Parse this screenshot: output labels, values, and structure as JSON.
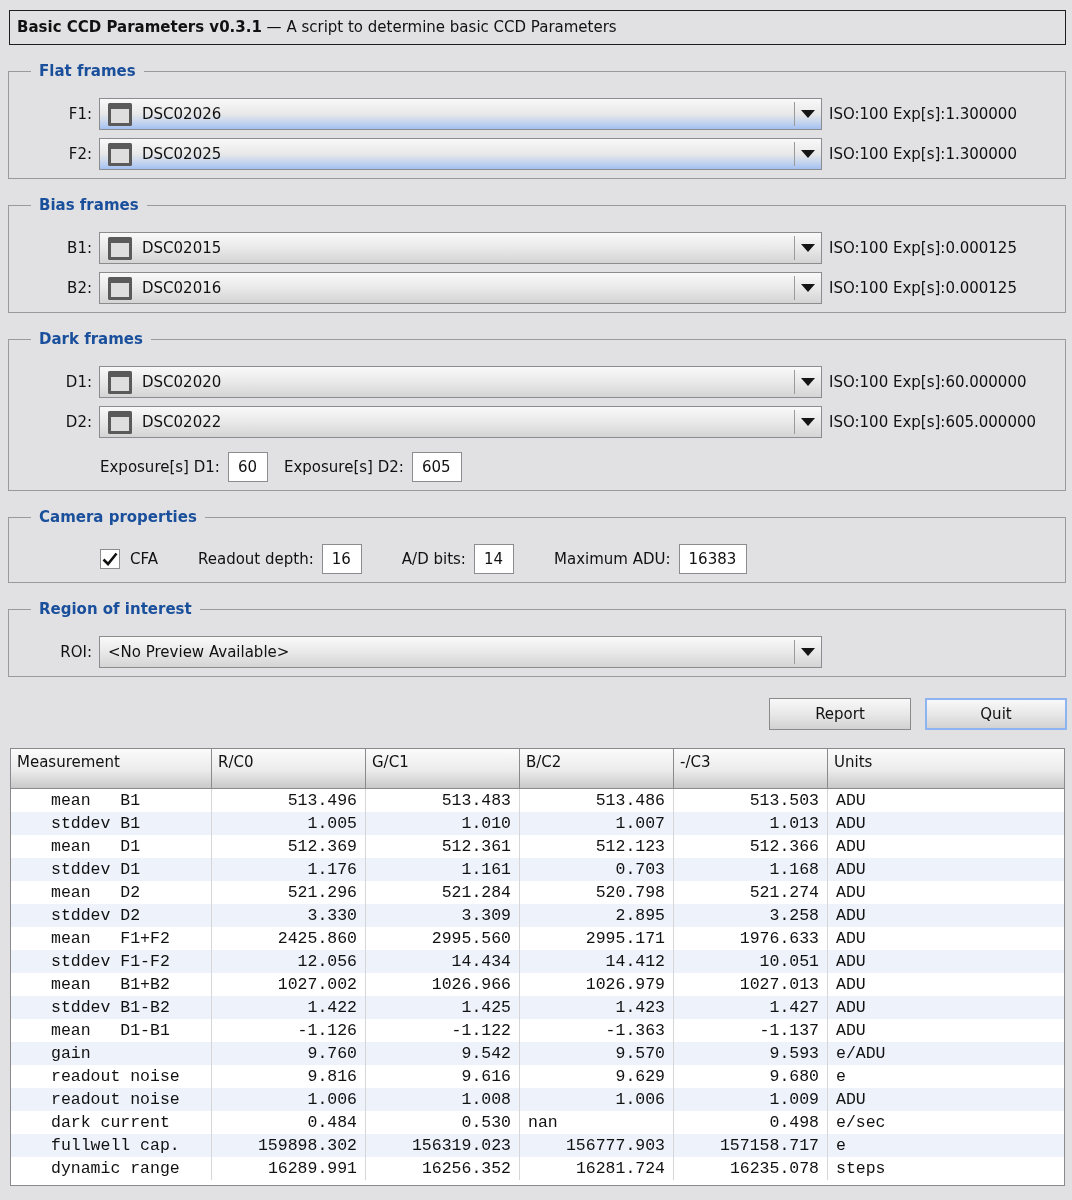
{
  "title": "**Basic CCD Parameters v0.3.1** — A script to determine basic CCD Parameters",
  "groups": [
    {
      "title": "Flat frames",
      "combos": [
        {
          "kind": "image",
          "label": "F1:",
          "value": "DSC02026",
          "highlighted": true,
          "info": "ISO:100 Exp[s]:1.300000"
        },
        {
          "kind": "image",
          "label": "F2:",
          "value": "DSC02025",
          "highlighted": true,
          "info": "ISO:100 Exp[s]:1.300000"
        }
      ]
    },
    {
      "title": "Bias frames",
      "combos": [
        {
          "kind": "image",
          "label": "B1:",
          "value": "DSC02015",
          "highlighted": false,
          "info": "ISO:100 Exp[s]:0.000125"
        },
        {
          "kind": "image",
          "label": "B2:",
          "value": "DSC02016",
          "highlighted": false,
          "info": "ISO:100 Exp[s]:0.000125"
        }
      ]
    },
    {
      "title": "Dark frames",
      "combos": [
        {
          "kind": "image",
          "label": "D1:",
          "value": "DSC02020",
          "highlighted": false,
          "info": "ISO:100 Exp[s]:60.000000"
        },
        {
          "kind": "image",
          "label": "D2:",
          "value": "DSC02022",
          "highlighted": false,
          "info": "ISO:100 Exp[s]:605.000000"
        }
      ],
      "fields": [
        {
          "kind": "number",
          "label": "Exposure[s] D1:",
          "value": "60"
        },
        {
          "kind": "number",
          "label": "Exposure[s] D2:",
          "value": "605"
        }
      ]
    },
    {
      "title": "Camera properties",
      "fields": [
        {
          "kind": "checkbox",
          "label": "CFA",
          "checked": true
        },
        {
          "kind": "number",
          "label": "Readout depth:",
          "value": "16"
        },
        {
          "kind": "number",
          "label": "A/D bits:",
          "value": "14"
        },
        {
          "kind": "number",
          "label": "Maximum ADU:",
          "value": "16383"
        }
      ]
    },
    {
      "title": "Region of interest",
      "combos": [
        {
          "kind": "text",
          "label": "ROI:",
          "value": "<No Preview Available>",
          "highlighted": false
        }
      ]
    }
  ],
  "buttons": [
    {
      "label": "Report",
      "default": false
    },
    {
      "label": "Quit",
      "default": true
    }
  ],
  "table": {
    "columns": [
      "Measurement",
      "R/C0",
      "G/C1",
      "B/C2",
      "-/C3",
      "Units"
    ],
    "rows": [
      {
        "measurement": "mean   B1",
        "values": [
          {
            "text": "513.496",
            "kind": "number"
          },
          {
            "text": "513.483",
            "kind": "number"
          },
          {
            "text": "513.486",
            "kind": "number"
          },
          {
            "text": "513.503",
            "kind": "number"
          }
        ],
        "units": "ADU"
      },
      {
        "measurement": "stddev B1",
        "values": [
          {
            "text": "1.005",
            "kind": "number"
          },
          {
            "text": "1.010",
            "kind": "number"
          },
          {
            "text": "1.007",
            "kind": "number"
          },
          {
            "text": "1.013",
            "kind": "number"
          }
        ],
        "units": "ADU"
      },
      {
        "measurement": "mean   D1",
        "values": [
          {
            "text": "512.369",
            "kind": "number"
          },
          {
            "text": "512.361",
            "kind": "number"
          },
          {
            "text": "512.123",
            "kind": "number"
          },
          {
            "text": "512.366",
            "kind": "number"
          }
        ],
        "units": "ADU"
      },
      {
        "measurement": "stddev D1",
        "values": [
          {
            "text": "1.176",
            "kind": "number"
          },
          {
            "text": "1.161",
            "kind": "number"
          },
          {
            "text": "0.703",
            "kind": "number"
          },
          {
            "text": "1.168",
            "kind": "number"
          }
        ],
        "units": "ADU"
      },
      {
        "measurement": "mean   D2",
        "values": [
          {
            "text": "521.296",
            "kind": "number"
          },
          {
            "text": "521.284",
            "kind": "number"
          },
          {
            "text": "520.798",
            "kind": "number"
          },
          {
            "text": "521.274",
            "kind": "number"
          }
        ],
        "units": "ADU"
      },
      {
        "measurement": "stddev D2",
        "values": [
          {
            "text": "3.330",
            "kind": "number"
          },
          {
            "text": "3.309",
            "kind": "number"
          },
          {
            "text": "2.895",
            "kind": "number"
          },
          {
            "text": "3.258",
            "kind": "number"
          }
        ],
        "units": "ADU"
      },
      {
        "measurement": "mean   F1+F2",
        "values": [
          {
            "text": "2425.860",
            "kind": "number"
          },
          {
            "text": "2995.560",
            "kind": "number"
          },
          {
            "text": "2995.171",
            "kind": "number"
          },
          {
            "text": "1976.633",
            "kind": "number"
          }
        ],
        "units": "ADU"
      },
      {
        "measurement": "stddev F1-F2",
        "values": [
          {
            "text": "12.056",
            "kind": "number"
          },
          {
            "text": "14.434",
            "kind": "number"
          },
          {
            "text": "14.412",
            "kind": "number"
          },
          {
            "text": "10.051",
            "kind": "number"
          }
        ],
        "units": "ADU"
      },
      {
        "measurement": "mean   B1+B2",
        "values": [
          {
            "text": "1027.002",
            "kind": "number"
          },
          {
            "text": "1026.966",
            "kind": "number"
          },
          {
            "text": "1026.979",
            "kind": "number"
          },
          {
            "text": "1027.013",
            "kind": "number"
          }
        ],
        "units": "ADU"
      },
      {
        "measurement": "stddev B1-B2",
        "values": [
          {
            "text": "1.422",
            "kind": "number"
          },
          {
            "text": "1.425",
            "kind": "number"
          },
          {
            "text": "1.423",
            "kind": "number"
          },
          {
            "text": "1.427",
            "kind": "number"
          }
        ],
        "units": "ADU"
      },
      {
        "measurement": "mean   D1-B1",
        "values": [
          {
            "text": "-1.126",
            "kind": "number"
          },
          {
            "text": "-1.122",
            "kind": "number"
          },
          {
            "text": "-1.363",
            "kind": "number"
          },
          {
            "text": "-1.137",
            "kind": "number"
          }
        ],
        "units": "ADU"
      },
      {
        "measurement": "gain",
        "values": [
          {
            "text": "9.760",
            "kind": "number"
          },
          {
            "text": "9.542",
            "kind": "number"
          },
          {
            "text": "9.570",
            "kind": "number"
          },
          {
            "text": "9.593",
            "kind": "number"
          }
        ],
        "units": "e/ADU"
      },
      {
        "measurement": "readout noise",
        "values": [
          {
            "text": "9.816",
            "kind": "number"
          },
          {
            "text": "9.616",
            "kind": "number"
          },
          {
            "text": "9.629",
            "kind": "number"
          },
          {
            "text": "9.680",
            "kind": "number"
          }
        ],
        "units": "e"
      },
      {
        "measurement": "readout noise",
        "values": [
          {
            "text": "1.006",
            "kind": "number"
          },
          {
            "text": "1.008",
            "kind": "number"
          },
          {
            "text": "1.006",
            "kind": "number"
          },
          {
            "text": "1.009",
            "kind": "number"
          }
        ],
        "units": "ADU"
      },
      {
        "measurement": "dark current",
        "values": [
          {
            "text": "0.484",
            "kind": "number"
          },
          {
            "text": "0.530",
            "kind": "number"
          },
          {
            "text": "nan",
            "kind": "text"
          },
          {
            "text": "0.498",
            "kind": "number"
          }
        ],
        "units": "e/sec"
      },
      {
        "measurement": "fullwell cap.",
        "values": [
          {
            "text": "159898.302",
            "kind": "number"
          },
          {
            "text": "156319.023",
            "kind": "number"
          },
          {
            "text": "156777.903",
            "kind": "number"
          },
          {
            "text": "157158.717",
            "kind": "number"
          }
        ],
        "units": "e"
      },
      {
        "measurement": "dynamic range",
        "values": [
          {
            "text": "16289.991",
            "kind": "number"
          },
          {
            "text": "16256.352",
            "kind": "number"
          },
          {
            "text": "16281.724",
            "kind": "number"
          },
          {
            "text": "16235.078",
            "kind": "number"
          }
        ],
        "units": "steps"
      }
    ]
  }
}
